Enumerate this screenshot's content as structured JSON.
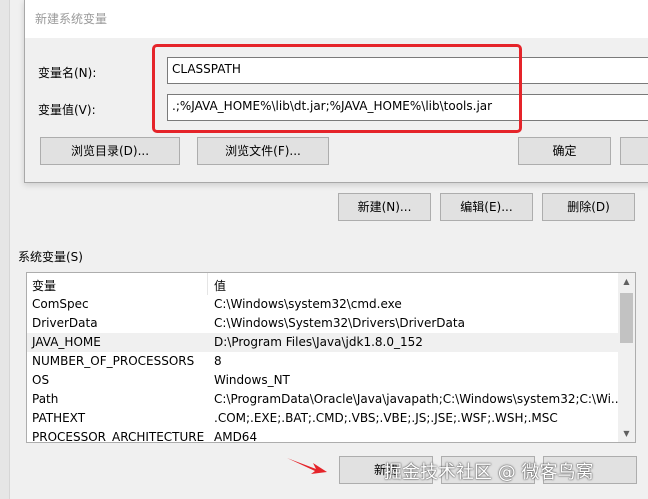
{
  "dialog": {
    "title": "新建系统变量",
    "var_name_label": "变量名(N):",
    "var_name_value": "CLASSPATH",
    "var_value_label": "变量值(V):",
    "var_value_value": ".;%JAVA_HOME%\\lib\\dt.jar;%JAVA_HOME%\\lib\\tools.jar",
    "browse_dir_label": "浏览目录(D)...",
    "browse_file_label": "浏览文件(F)...",
    "ok_label": "确定"
  },
  "user_vars_buttons": {
    "new_label": "新建(N)...",
    "edit_label": "编辑(E)...",
    "delete_label": "删除(D)"
  },
  "system_vars": {
    "title": "系统变量(S)",
    "columns": [
      "变量",
      "值"
    ],
    "rows": [
      {
        "name": "ComSpec",
        "value": "C:\\Windows\\system32\\cmd.exe"
      },
      {
        "name": "DriverData",
        "value": "C:\\Windows\\System32\\Drivers\\DriverData"
      },
      {
        "name": "JAVA_HOME",
        "value": "D:\\Program Files\\Java\\jdk1.8.0_152"
      },
      {
        "name": "NUMBER_OF_PROCESSORS",
        "value": "8"
      },
      {
        "name": "OS",
        "value": "Windows_NT"
      },
      {
        "name": "Path",
        "value": "C:\\ProgramData\\Oracle\\Java\\javapath;C:\\Windows\\system32;C:\\Wi..."
      },
      {
        "name": "PATHEXT",
        "value": ".COM;.EXE;.BAT;.CMD;.VBS;.VBE;.JS;.JSE;.WSF;.WSH;.MSC"
      },
      {
        "name": "PROCESSOR_ARCHITECTURE",
        "value": "AMD64"
      }
    ],
    "new_label": "新建"
  },
  "watermark": "掘金技术社区 @ 微客鸟窝",
  "colors": {
    "highlight_box": "#e5242a",
    "arrow": "#e5242a"
  }
}
